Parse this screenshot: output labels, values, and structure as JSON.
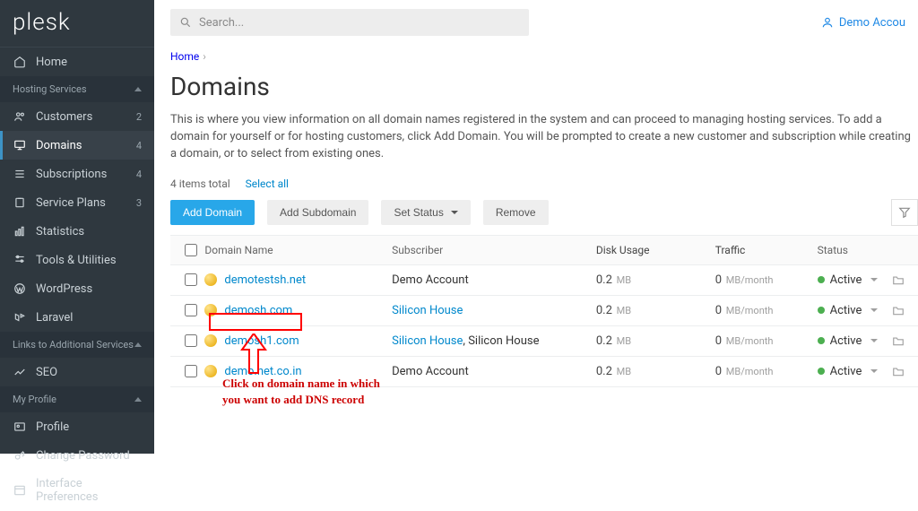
{
  "brand": "plesk",
  "sidebar": {
    "home_label": "Home",
    "section_hosting": "Hosting Services",
    "section_links": "Links to Additional Services",
    "section_profile": "My Profile",
    "items": [
      {
        "label": "Customers",
        "badge": "2"
      },
      {
        "label": "Domains",
        "badge": "4"
      },
      {
        "label": "Subscriptions",
        "badge": "4"
      },
      {
        "label": "Service Plans",
        "badge": "3"
      },
      {
        "label": "Statistics"
      },
      {
        "label": "Tools & Utilities"
      },
      {
        "label": "WordPress"
      },
      {
        "label": "Laravel"
      }
    ],
    "links_items": [
      {
        "label": "SEO"
      }
    ],
    "profile_items": [
      {
        "label": "Profile"
      },
      {
        "label": "Change Password"
      },
      {
        "label": "Interface Preferences"
      }
    ]
  },
  "header": {
    "search_placeholder": "Search...",
    "user_label": "Demo Accou"
  },
  "breadcrumb": {
    "home": "Home"
  },
  "page": {
    "title": "Domains",
    "description": "This is where you view information on all domain names registered in the system and can proceed to managing hosting services. To add a domain for yourself or for hosting customers, click Add Domain. You will be prompted to create a new customer and subscription while creating a domain, or to select from existing ones.",
    "items_total": "4 items total",
    "select_all": "Select all"
  },
  "toolbar": {
    "add_domain": "Add Domain",
    "add_subdomain": "Add Subdomain",
    "set_status": "Set Status",
    "remove": "Remove"
  },
  "table": {
    "headers": {
      "domain": "Domain Name",
      "subscriber": "Subscriber",
      "disk": "Disk Usage",
      "traffic": "Traffic",
      "status": "Status"
    },
    "rows": [
      {
        "domain": "demotestsh.net",
        "subscriber_text": "Demo Account",
        "subscriber_link": false,
        "disk_val": "0.2",
        "disk_unit": "MB",
        "traffic_val": "0",
        "traffic_unit": "MB/month",
        "status": "Active"
      },
      {
        "domain": "demosh.com",
        "subscriber_text": "Silicon House",
        "subscriber_link": true,
        "disk_val": "0.2",
        "disk_unit": "MB",
        "traffic_val": "0",
        "traffic_unit": "MB/month",
        "status": "Active"
      },
      {
        "domain": "demosh1.com",
        "subscriber_text": "Silicon House",
        "subscriber_suffix": ", Silicon House",
        "subscriber_link": true,
        "disk_val": "0.2",
        "disk_unit": "MB",
        "traffic_val": "0",
        "traffic_unit": "MB/month",
        "status": "Active"
      },
      {
        "domain": "demo.net.co.in",
        "subscriber_text": "Demo Account",
        "subscriber_link": false,
        "disk_val": "0.2",
        "disk_unit": "MB",
        "traffic_val": "0",
        "traffic_unit": "MB/month",
        "status": "Active"
      }
    ]
  },
  "annotation": {
    "line1": "Click on domain name in which",
    "line2": "you want to add DNS record"
  }
}
